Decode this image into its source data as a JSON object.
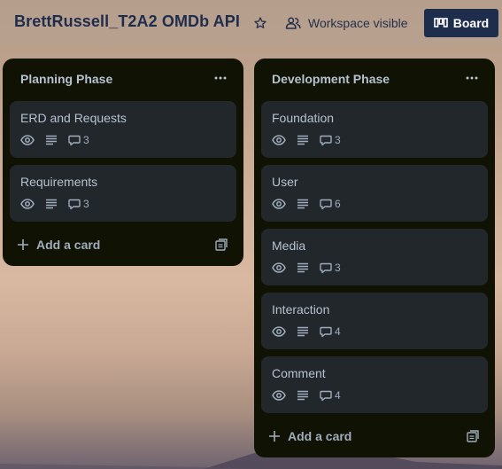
{
  "header": {
    "board_title": "BrettRussell_T2A2 OMDb API",
    "visibility_label": "Workspace visible",
    "view_label": "Board"
  },
  "lists": [
    {
      "title": "Planning Phase",
      "add_card_label": "Add a card",
      "cards": [
        {
          "title": "ERD and Requests",
          "comments": "3"
        },
        {
          "title": "Requirements",
          "comments": "3"
        }
      ]
    },
    {
      "title": "Development Phase",
      "add_card_label": "Add a card",
      "cards": [
        {
          "title": "Foundation",
          "comments": "3"
        },
        {
          "title": "User",
          "comments": "6"
        },
        {
          "title": "Media",
          "comments": "3"
        },
        {
          "title": "Interaction",
          "comments": "4"
        },
        {
          "title": "Comment",
          "comments": "4"
        }
      ]
    }
  ],
  "colors": {
    "list_bg": "#101204",
    "card_bg": "#22272b",
    "text": "#b6c2cf",
    "header_title": "#1f2d4d",
    "board_button_bg": "#1f2d4d"
  },
  "icons": {
    "star": "star-icon",
    "visibility": "people-icon",
    "board": "board-view-icon",
    "list_menu": "ellipsis-icon",
    "watch": "eye-icon",
    "description": "description-icon",
    "comments": "comment-icon",
    "add": "plus-icon",
    "template": "template-icon"
  }
}
